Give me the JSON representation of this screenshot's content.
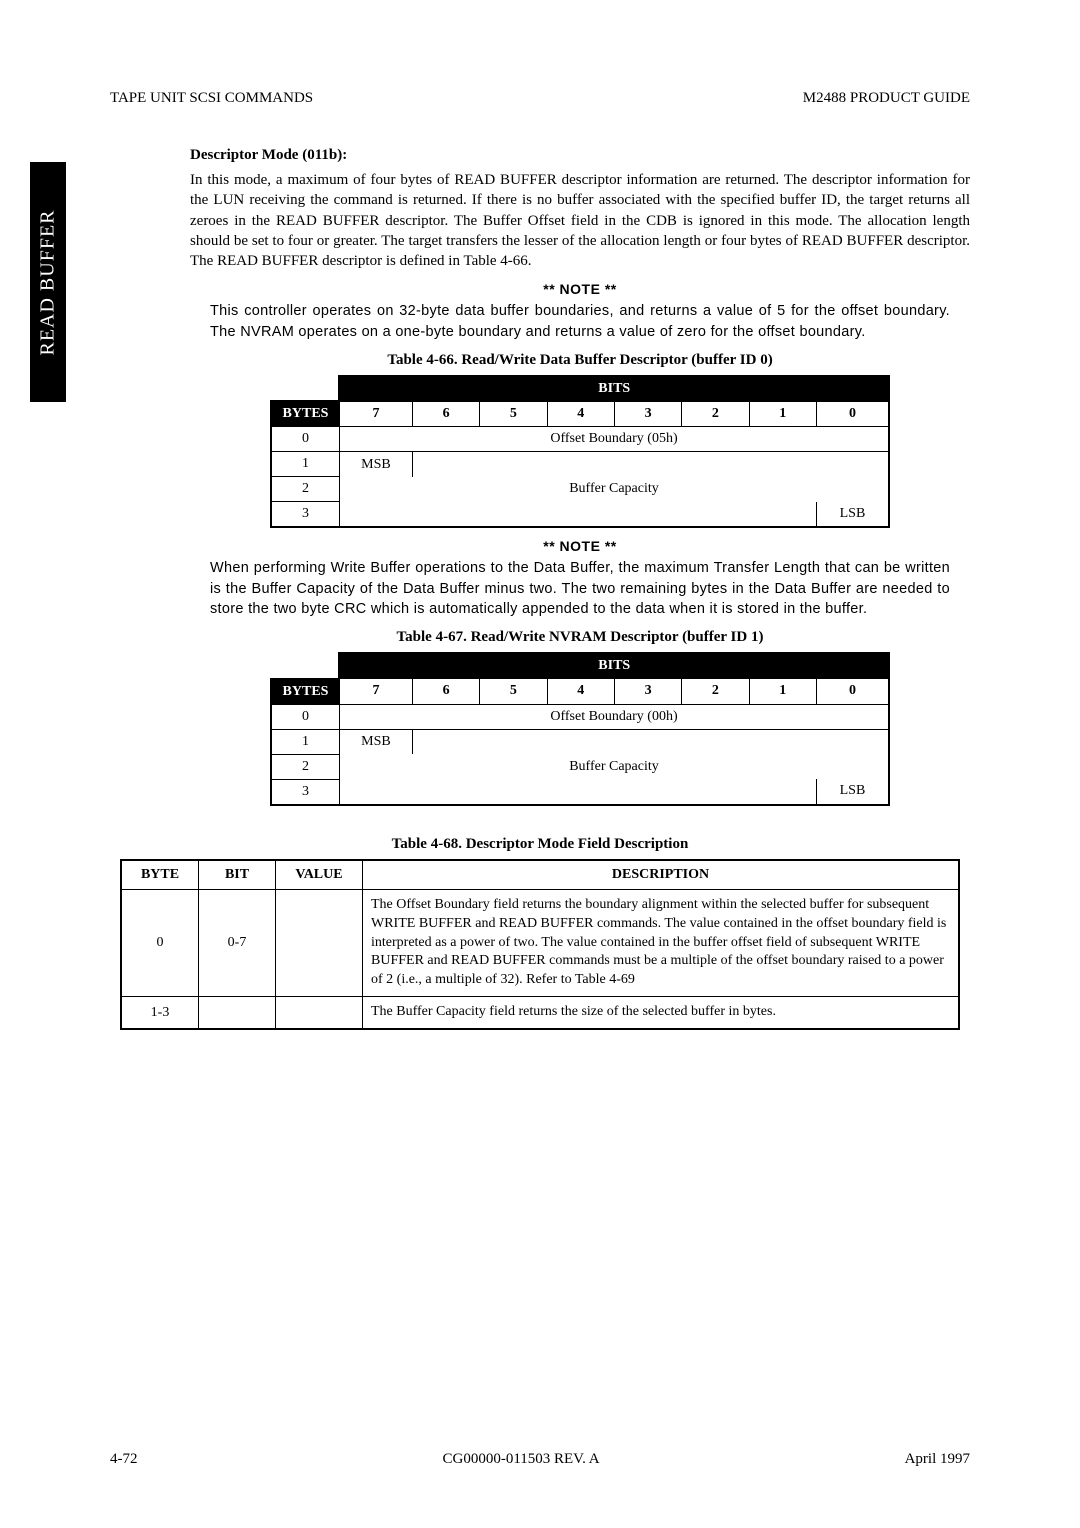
{
  "header": {
    "left": "TAPE UNIT SCSI COMMANDS",
    "right": "M2488 PRODUCT GUIDE"
  },
  "side_tab": "READ BUFFER",
  "section": {
    "heading": "Descriptor Mode (011b):",
    "para": "In this mode, a maximum of four bytes of READ BUFFER descriptor information are returned. The descriptor information for the LUN receiving the command is returned. If there is no buffer associated with the specified buffer ID, the target returns all zeroes in the READ BUFFER descriptor. The Buffer Offset field in the CDB is ignored in this mode. The allocation length should be set to four or greater. The target transfers the lesser of the allocation length or four bytes of READ BUFFER descriptor. The READ BUFFER descriptor is defined in Table 4-66."
  },
  "note1": {
    "head": "** NOTE **",
    "body": "This controller operates on 32-byte data buffer boundaries, and returns a value of 5 for the offset boundary.   The NVRAM operates on a one-byte boundary and returns a value of zero for the offset boundary."
  },
  "table66": {
    "caption": "Table 4-66.   Read/Write Data Buffer Descriptor (buffer ID 0)",
    "bits_label": "BITS",
    "bytes_label": "BYTES",
    "bits": [
      "7",
      "6",
      "5",
      "4",
      "3",
      "2",
      "1",
      "0"
    ],
    "rows_label": [
      "0",
      "1",
      "2",
      "3"
    ],
    "row0": "Offset Boundary (05h)",
    "msb": "MSB",
    "mid": "Buffer Capacity",
    "lsb": "LSB"
  },
  "note2": {
    "head": "** NOTE **",
    "body": "When performing Write Buffer operations to the Data Buffer, the maximum Transfer Length that can be written is the Buffer Capacity of the Data Buffer minus two. The two remaining bytes in the Data Buffer are needed to store the two byte CRC which is automatically appended to the data when it is stored in the buffer."
  },
  "table67": {
    "caption": "Table 4-67.   Read/Write NVRAM Descriptor (buffer ID 1)",
    "bits_label": "BITS",
    "bytes_label": "BYTES",
    "bits": [
      "7",
      "6",
      "5",
      "4",
      "3",
      "2",
      "1",
      "0"
    ],
    "rows_label": [
      "0",
      "1",
      "2",
      "3"
    ],
    "row0": "Offset Boundary (00h)",
    "msb": "MSB",
    "mid": "Buffer Capacity",
    "lsb": "LSB"
  },
  "table68": {
    "caption": "Table 4-68.   Descriptor Mode Field Description",
    "headers": [
      "BYTE",
      "BIT",
      "VALUE",
      "DESCRIPTION"
    ],
    "rows": [
      {
        "byte": "0",
        "bit": "0-7",
        "value": "",
        "desc": "The Offset Boundary field returns the boundary alignment within the selected buffer for subsequent WRITE BUFFER and READ BUFFER commands. The value contained in the offset boundary field is interpreted as a power of two.\nThe value contained in the buffer offset field of subsequent WRITE BUFFER and READ BUFFER commands must be a multiple of the offset boundary raised to a power of 2 (i.e., a multiple of 32). Refer to Table 4-69"
      },
      {
        "byte": "1-3",
        "bit": "",
        "value": "",
        "desc": "The Buffer Capacity field returns the size of the selected buffer in bytes."
      }
    ]
  },
  "footer": {
    "left": "4-72",
    "center": "CG00000-011503 REV. A",
    "right": "April 1997"
  }
}
